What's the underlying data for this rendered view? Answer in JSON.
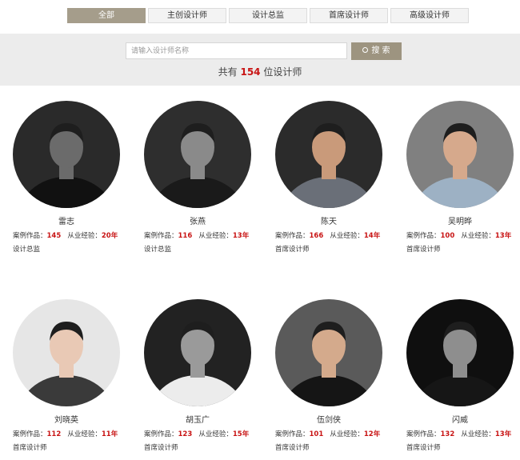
{
  "tabs": [
    "全部",
    "主创设计师",
    "设计总监",
    "首席设计师",
    "高级设计师"
  ],
  "search": {
    "placeholder": "请输入设计师名称",
    "button": "搜 索"
  },
  "count": {
    "prefix": "共有",
    "value": "154",
    "suffix": "位设计师"
  },
  "labels": {
    "works": "案例作品：",
    "exp": "从业经验：",
    "year_unit": "年"
  },
  "designers": [
    {
      "name": "雷志",
      "works": "145",
      "years": "20",
      "title": "设计总监",
      "bg": "#2a2a2a",
      "skin": "#6b6b6b",
      "cloth": "#111"
    },
    {
      "name": "张燕",
      "works": "116",
      "years": "13",
      "title": "设计总监",
      "bg": "#2e2e2e",
      "skin": "#8a8a8a",
      "cloth": "#1a1a1a"
    },
    {
      "name": "陈天",
      "works": "166",
      "years": "14",
      "title": "首席设计师",
      "bg": "#2b2b2b",
      "skin": "#c99a7a",
      "cloth": "#6a6f78"
    },
    {
      "name": "吴明晔",
      "works": "100",
      "years": "13",
      "title": "首席设计师",
      "bg": "#808080",
      "skin": "#d6a98c",
      "cloth": "#9db1c4"
    },
    {
      "name": "刘晓英",
      "works": "112",
      "years": "11",
      "title": "首席设计师",
      "bg": "#e6e6e6",
      "skin": "#e9c9b5",
      "cloth": "#3a3a3a"
    },
    {
      "name": "胡玉广",
      "works": "123",
      "years": "15",
      "title": "首席设计师",
      "bg": "#222",
      "skin": "#9a9a9a",
      "cloth": "#ececec"
    },
    {
      "name": "伍剑侠",
      "works": "101",
      "years": "12",
      "title": "首席设计师",
      "bg": "#5a5a5a",
      "skin": "#d4aa8c",
      "cloth": "#151515"
    },
    {
      "name": "闪威",
      "works": "132",
      "years": "13",
      "title": "首席设计师",
      "bg": "#0f0f0f",
      "skin": "#8e8e8e",
      "cloth": "#161616"
    }
  ]
}
